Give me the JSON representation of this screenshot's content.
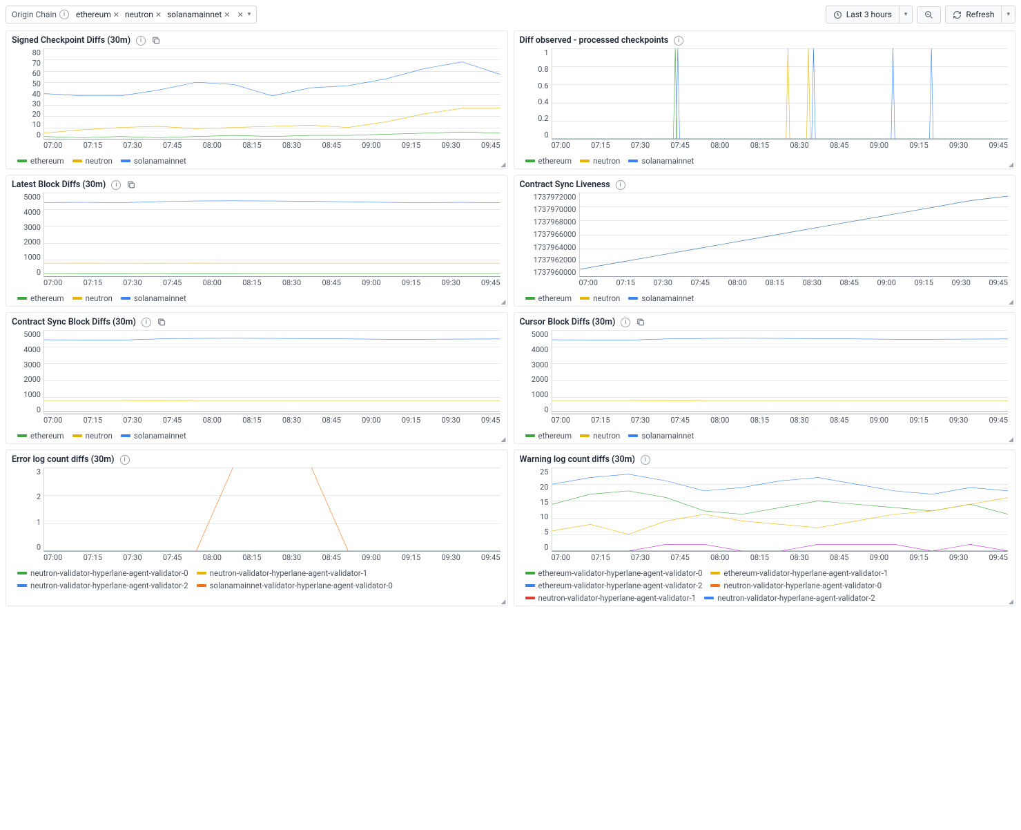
{
  "colors": {
    "ethereum": "#3ca63c",
    "neutron": "#e5b300",
    "solanamainnet": "#3b82f6",
    "red": "#e03c31",
    "orange": "#f97316",
    "magenta": "#c026d3"
  },
  "filter": {
    "label": "Origin Chain",
    "chips": [
      "ethereum",
      "neutron",
      "solanamainnet"
    ]
  },
  "toolbar": {
    "time_label": "Last 3 hours",
    "refresh_label": "Refresh"
  },
  "x_ticks": [
    "07:00",
    "07:15",
    "07:30",
    "07:45",
    "08:00",
    "08:15",
    "08:30",
    "08:45",
    "09:00",
    "09:15",
    "09:30",
    "09:45"
  ],
  "panels": [
    {
      "id": "p1",
      "title": "Signed Checkpoint Diffs (30m)",
      "info": true,
      "extra_icon": true
    },
    {
      "id": "p2",
      "title": "Diff observed - processed checkpoints",
      "info": true,
      "extra_icon": false
    },
    {
      "id": "p3",
      "title": "Latest Block Diffs (30m)",
      "info": true,
      "extra_icon": true
    },
    {
      "id": "p4",
      "title": "Contract Sync Liveness",
      "info": true,
      "extra_icon": false
    },
    {
      "id": "p5",
      "title": "Contract Sync Block Diffs (30m)",
      "info": true,
      "extra_icon": true
    },
    {
      "id": "p6",
      "title": "Cursor Block Diffs (30m)",
      "info": true,
      "extra_icon": true
    },
    {
      "id": "p7",
      "title": "Error log count diffs (30m)",
      "info": true,
      "extra_icon": false
    },
    {
      "id": "p8",
      "title": "Warning log count diffs (30m)",
      "info": true,
      "extra_icon": false
    }
  ],
  "chart_data": [
    {
      "id": "p1",
      "type": "line",
      "title": "Signed Checkpoint Diffs (30m)",
      "ylim": [
        0,
        80
      ],
      "yticks": [
        0,
        10,
        20,
        30,
        40,
        50,
        60,
        70,
        80
      ],
      "x": [
        "07:00",
        "07:15",
        "07:30",
        "07:45",
        "08:00",
        "08:15",
        "08:30",
        "08:45",
        "09:00",
        "09:15",
        "09:30",
        "09:45",
        "09:55"
      ],
      "series": [
        {
          "name": "ethereum",
          "color": "#3ca63c",
          "values": [
            2,
            1,
            2,
            1,
            2,
            3,
            2,
            3,
            3,
            4,
            5,
            6,
            5
          ]
        },
        {
          "name": "neutron",
          "color": "#e5b300",
          "values": [
            5,
            8,
            10,
            11,
            9,
            10,
            11,
            12,
            10,
            15,
            22,
            27,
            27
          ]
        },
        {
          "name": "solanamainnet",
          "color": "#3b82f6",
          "values": [
            40,
            38,
            38,
            43,
            50,
            48,
            38,
            45,
            47,
            53,
            62,
            68,
            57
          ]
        }
      ],
      "legend": [
        "ethereum",
        "neutron",
        "solanamainnet"
      ]
    },
    {
      "id": "p2",
      "type": "line",
      "title": "Diff observed - processed checkpoints",
      "ylim": [
        0,
        1
      ],
      "yticks": [
        0,
        0.2,
        0.4,
        0.6,
        0.8,
        1
      ],
      "x": [
        "07:00",
        "07:15",
        "07:30",
        "07:45",
        "08:00",
        "08:15",
        "08:30",
        "08:45",
        "09:00",
        "09:15",
        "09:30",
        "09:45"
      ],
      "series": [
        {
          "name": "ethereum",
          "color": "#3ca63c",
          "spikes": [
            {
              "x": "07:48",
              "v": 1
            }
          ]
        },
        {
          "name": "neutron",
          "color": "#e5b300",
          "spikes": [
            {
              "x": "08:32",
              "v": 1
            },
            {
              "x": "08:40",
              "v": 1
            }
          ]
        },
        {
          "name": "solanamainnet",
          "color": "#3b82f6",
          "spikes": [
            {
              "x": "07:49",
              "v": 1
            },
            {
              "x": "08:42",
              "v": 1
            },
            {
              "x": "09:13",
              "v": 1
            },
            {
              "x": "09:28",
              "v": 1
            }
          ]
        }
      ],
      "legend": [
        "ethereum",
        "neutron",
        "solanamainnet"
      ]
    },
    {
      "id": "p3",
      "type": "line",
      "title": "Latest Block Diffs (30m)",
      "ylim": [
        0,
        5000
      ],
      "yticks": [
        0,
        1000,
        2000,
        3000,
        4000,
        5000
      ],
      "x": [
        "07:00",
        "07:15",
        "07:30",
        "07:45",
        "08:00",
        "08:15",
        "08:30",
        "08:45",
        "09:00",
        "09:15",
        "09:30",
        "09:45",
        "09:55"
      ],
      "series": [
        {
          "name": "ethereum",
          "color": "#3ca63c",
          "values": [
            150,
            148,
            152,
            150,
            151,
            149,
            150,
            150,
            150,
            150,
            150,
            150,
            150
          ]
        },
        {
          "name": "neutron",
          "color": "#e5b300",
          "values": [
            780,
            782,
            780,
            779,
            781,
            780,
            780,
            780,
            780,
            780,
            780,
            780,
            780
          ]
        },
        {
          "name": "solanamainnet",
          "color": "#3b82f6",
          "values": [
            4410,
            4420,
            4400,
            4460,
            4500,
            4510,
            4500,
            4480,
            4450,
            4420,
            4400,
            4420,
            4400
          ]
        }
      ],
      "legend": [
        "ethereum",
        "neutron",
        "solanamainnet"
      ]
    },
    {
      "id": "p4",
      "type": "line",
      "title": "Contract Sync Liveness",
      "ylim": [
        1737960000,
        1737972000
      ],
      "yticks": [
        1737960000,
        1737962000,
        1737964000,
        1737966000,
        1737968000,
        1737970000,
        1737972000
      ],
      "x": [
        "07:00",
        "07:15",
        "07:30",
        "07:45",
        "08:00",
        "08:15",
        "08:30",
        "08:45",
        "09:00",
        "09:15",
        "09:30",
        "09:45",
        "09:55"
      ],
      "series": [
        {
          "name": "ethereum",
          "color": "#3ca63c",
          "values": [
            1737961000,
            1737961900,
            1737962800,
            1737963700,
            1737964600,
            1737965500,
            1737966400,
            1737967300,
            1737968200,
            1737969100,
            1737970000,
            1737970900,
            1737971500
          ]
        },
        {
          "name": "neutron",
          "color": "#e5b300",
          "values": [
            1737961000,
            1737961900,
            1737962800,
            1737963700,
            1737964600,
            1737965500,
            1737966400,
            1737967300,
            1737968200,
            1737969100,
            1737970000,
            1737970900,
            1737971500
          ]
        },
        {
          "name": "solanamainnet",
          "color": "#3b82f6",
          "values": [
            1737961000,
            1737961900,
            1737962800,
            1737963700,
            1737964600,
            1737965500,
            1737966400,
            1737967300,
            1737968200,
            1737969100,
            1737970000,
            1737970900,
            1737971500
          ]
        }
      ],
      "legend": [
        "ethereum",
        "neutron",
        "solanamainnet"
      ]
    },
    {
      "id": "p5",
      "type": "line",
      "title": "Contract Sync Block Diffs (30m)",
      "ylim": [
        0,
        5000
      ],
      "yticks": [
        0,
        1000,
        2000,
        3000,
        4000,
        5000
      ],
      "x": [
        "07:00",
        "07:15",
        "07:30",
        "07:45",
        "08:00",
        "08:15",
        "08:30",
        "08:45",
        "09:00",
        "09:15",
        "09:30",
        "09:45",
        "09:55"
      ],
      "series": [
        {
          "name": "ethereum",
          "color": "#3ca63c",
          "values": [
            150,
            150,
            150,
            150,
            150,
            150,
            150,
            150,
            150,
            150,
            150,
            150,
            150
          ]
        },
        {
          "name": "neutron",
          "color": "#e5b300",
          "values": [
            780,
            780,
            780,
            760,
            780,
            780,
            780,
            780,
            780,
            780,
            780,
            780,
            780
          ]
        },
        {
          "name": "solanamainnet",
          "color": "#3b82f6",
          "values": [
            4420,
            4410,
            4400,
            4470,
            4500,
            4510,
            4500,
            4490,
            4470,
            4450,
            4450,
            4460,
            4470
          ]
        }
      ],
      "legend": [
        "ethereum",
        "neutron",
        "solanamainnet"
      ]
    },
    {
      "id": "p6",
      "type": "line",
      "title": "Cursor Block Diffs (30m)",
      "ylim": [
        0,
        5000
      ],
      "yticks": [
        0,
        1000,
        2000,
        3000,
        4000,
        5000
      ],
      "x": [
        "07:00",
        "07:15",
        "07:30",
        "07:45",
        "08:00",
        "08:15",
        "08:30",
        "08:45",
        "09:00",
        "09:15",
        "09:30",
        "09:45",
        "09:55"
      ],
      "series": [
        {
          "name": "ethereum",
          "color": "#3ca63c",
          "values": [
            150,
            150,
            150,
            150,
            150,
            150,
            150,
            150,
            150,
            150,
            150,
            150,
            150
          ]
        },
        {
          "name": "neutron",
          "color": "#e5b300",
          "values": [
            780,
            780,
            780,
            760,
            780,
            780,
            780,
            780,
            780,
            780,
            780,
            780,
            780
          ]
        },
        {
          "name": "solanamainnet",
          "color": "#3b82f6",
          "values": [
            4420,
            4410,
            4400,
            4470,
            4500,
            4510,
            4500,
            4490,
            4470,
            4450,
            4450,
            4460,
            4470
          ]
        }
      ],
      "legend": [
        "ethereum",
        "neutron",
        "solanamainnet"
      ]
    },
    {
      "id": "p7",
      "type": "line",
      "title": "Error log count diffs (30m)",
      "ylim": [
        0,
        3
      ],
      "yticks": [
        0,
        1,
        2,
        3
      ],
      "x": [
        "07:00",
        "07:15",
        "07:30",
        "07:45",
        "08:00",
        "08:15",
        "08:30",
        "08:45",
        "09:00",
        "09:15",
        "09:30",
        "09:45",
        "09:55"
      ],
      "series": [
        {
          "name": "neutron-validator-hyperlane-agent-validator-0",
          "color": "#3ca63c",
          "values": [
            0,
            0,
            0,
            0,
            0,
            0,
            0,
            0,
            0,
            0,
            0,
            0,
            0
          ]
        },
        {
          "name": "neutron-validator-hyperlane-agent-validator-1",
          "color": "#e5b300",
          "values": [
            0,
            0,
            0,
            0,
            0,
            0,
            0,
            0,
            0,
            0,
            0,
            0,
            0
          ]
        },
        {
          "name": "neutron-validator-hyperlane-agent-validator-2",
          "color": "#3b82f6",
          "values": [
            0,
            0,
            0,
            0,
            0,
            0,
            0,
            0,
            0,
            0,
            0,
            0,
            0
          ]
        },
        {
          "name": "solanamainnet-validator-hyperlane-agent-validator-0",
          "color": "#f97316",
          "values": [
            0,
            0,
            0,
            0,
            0,
            3.1,
            3.1,
            3.1,
            0,
            0,
            0,
            0,
            0
          ]
        }
      ],
      "legend": [
        "neutron-validator-hyperlane-agent-validator-0",
        "neutron-validator-hyperlane-agent-validator-1",
        "neutron-validator-hyperlane-agent-validator-2",
        "solanamainnet-validator-hyperlane-agent-validator-0"
      ]
    },
    {
      "id": "p8",
      "type": "line",
      "title": "Warning log count diffs (30m)",
      "ylim": [
        0,
        25
      ],
      "yticks": [
        0,
        5,
        10,
        15,
        20,
        25
      ],
      "x": [
        "07:00",
        "07:15",
        "07:30",
        "07:45",
        "08:00",
        "08:15",
        "08:30",
        "08:45",
        "09:00",
        "09:15",
        "09:30",
        "09:45",
        "09:55"
      ],
      "series": [
        {
          "name": "ethereum-validator-hyperlane-agent-validator-0",
          "color": "#3ca63c",
          "values": [
            14,
            17,
            18,
            16,
            12,
            11,
            13,
            15,
            14,
            13,
            12,
            14,
            11
          ]
        },
        {
          "name": "ethereum-validator-hyperlane-agent-validator-1",
          "color": "#e5b300",
          "values": [
            6,
            8,
            5,
            9,
            11,
            9,
            8,
            7,
            9,
            11,
            12,
            14,
            16
          ]
        },
        {
          "name": "ethereum-validator-hyperlane-agent-validator-2",
          "color": "#3b82f6",
          "values": [
            20,
            22,
            23,
            21,
            18,
            19,
            21,
            22,
            20,
            18,
            17,
            19,
            18
          ]
        },
        {
          "name": "neutron-validator-hyperlane-agent-validator-0",
          "color": "#f97316",
          "values": [
            0,
            0,
            0,
            0,
            0,
            0,
            0,
            0,
            0,
            0,
            0,
            0,
            0
          ]
        },
        {
          "name": "neutron-validator-hyperlane-agent-validator-1",
          "color": "#e03c31",
          "values": [
            0,
            0,
            0,
            0,
            0,
            0,
            0,
            0,
            0,
            0,
            0,
            0,
            0
          ]
        },
        {
          "name": "neutron-validator-hyperlane-agent-validator-2",
          "color": "#3b82f6",
          "values": [
            0,
            0,
            0,
            0,
            0,
            0,
            0,
            0,
            0,
            0,
            0,
            0,
            0
          ]
        },
        {
          "name": "solanamainnet-validator-hyperlane-agent-validator-0",
          "color": "#c026d3",
          "values": [
            0,
            0,
            0,
            2,
            2,
            0,
            0,
            2,
            2,
            2,
            0,
            2,
            0
          ]
        }
      ],
      "legend": [
        "ethereum-validator-hyperlane-agent-validator-0",
        "ethereum-validator-hyperlane-agent-validator-1",
        "ethereum-validator-hyperlane-agent-validator-2",
        "neutron-validator-hyperlane-agent-validator-0",
        "neutron-validator-hyperlane-agent-validator-1",
        "neutron-validator-hyperlane-agent-validator-2"
      ]
    }
  ]
}
